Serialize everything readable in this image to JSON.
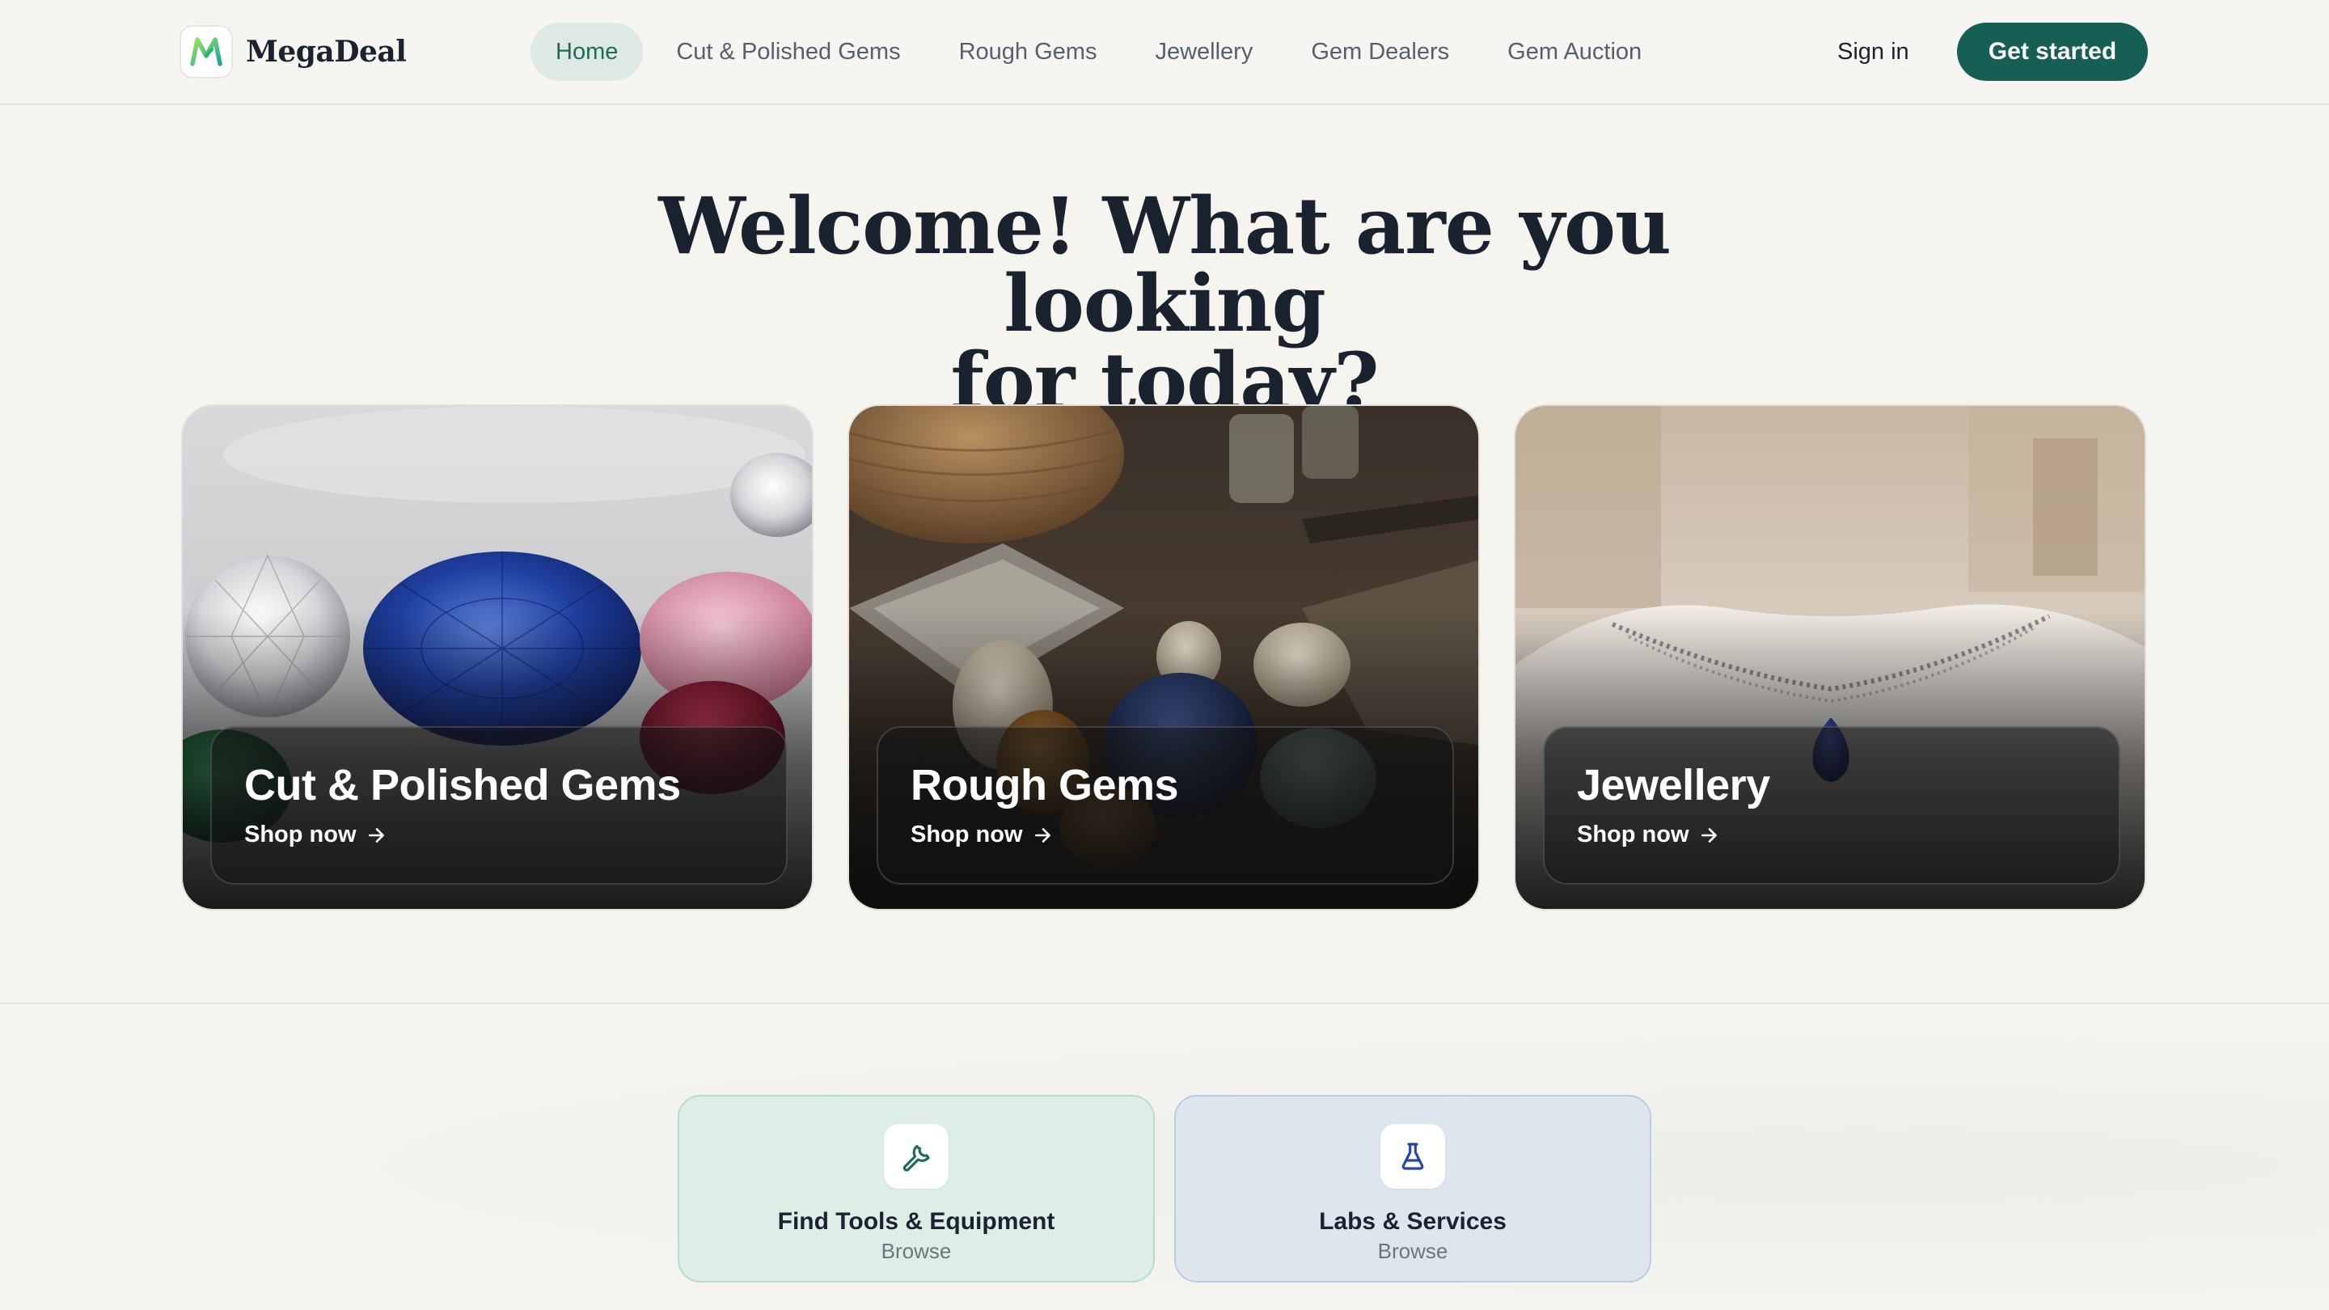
{
  "brand": {
    "name": "MegaDeal",
    "logo_icon": "megadeal-m-logo",
    "accent": "#155f55"
  },
  "nav": {
    "items": [
      {
        "label": "Home",
        "active": true
      },
      {
        "label": "Cut & Polished Gems",
        "active": false
      },
      {
        "label": "Rough Gems",
        "active": false
      },
      {
        "label": "Jewellery",
        "active": false
      },
      {
        "label": "Gem Dealers",
        "active": false
      },
      {
        "label": "Gem Auction",
        "active": false
      }
    ]
  },
  "auth": {
    "signin_label": "Sign in",
    "cta_label": "Get started"
  },
  "hero": {
    "line1": "Welcome! What are you looking",
    "line2": "for today?"
  },
  "categories": [
    {
      "title": "Cut & Polished Gems",
      "link": "Shop now",
      "icon": "arrow-right-icon"
    },
    {
      "title": "Rough Gems",
      "link": "Shop now",
      "icon": "arrow-right-icon"
    },
    {
      "title": "Jewellery",
      "link": "Shop now",
      "icon": "arrow-right-icon"
    }
  ],
  "tiles": [
    {
      "title": "Find Tools & Equipment",
      "subtitle": "Browse",
      "icon": "wrench-icon",
      "color": "#1c6b5c"
    },
    {
      "title": "Labs & Services",
      "subtitle": "Browse",
      "icon": "flask-icon",
      "color": "#2747a8"
    }
  ]
}
